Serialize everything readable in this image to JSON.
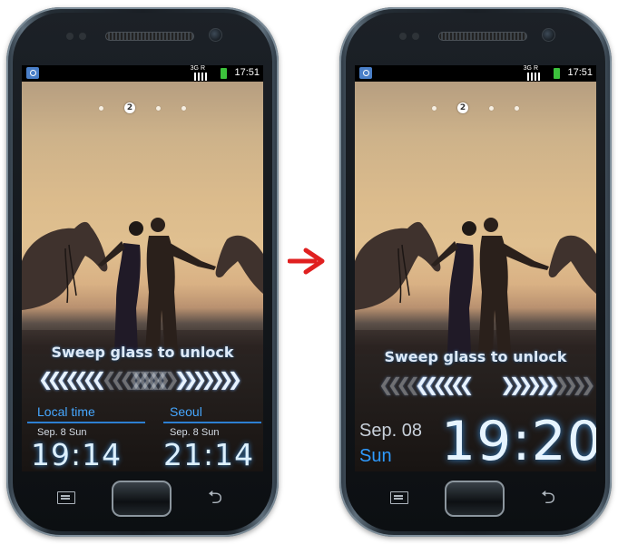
{
  "status_bar": {
    "network": "3G R",
    "time": "17:51"
  },
  "page_indicator": {
    "current": "2"
  },
  "lockscreen_before": {
    "unlock_hint": "Sweep glass to unlock",
    "arrows_left": "❮❮❮❮❮❮❮",
    "arrows_right": "❯❯❯❯❯❯❯",
    "clocks": [
      {
        "label": "Local time",
        "date": "Sep. 8 Sun",
        "time": "19:14"
      },
      {
        "label": "Seoul",
        "date": "Sep. 8 Sun",
        "time": "21:14"
      }
    ]
  },
  "lockscreen_after": {
    "unlock_hint": "Sweep glass to unlock",
    "arrows_left": "❮❮❮❮❮❮",
    "arrows_right": "❯❯❯❯❯❯",
    "date": "Sep. 08",
    "day": "Sun",
    "time": "19:20"
  },
  "colors": {
    "accent_blue": "#2f9bff",
    "transition_arrow": "#e02020"
  }
}
